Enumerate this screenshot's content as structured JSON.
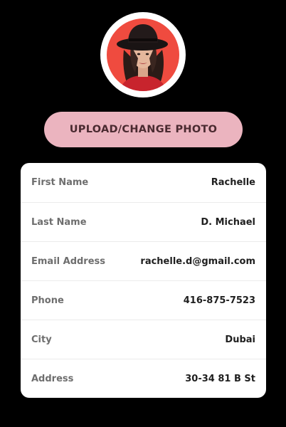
{
  "profile": {
    "avatar_icon": "profile-photo",
    "upload_button_label": "UPLOAD/CHANGE PHOTO"
  },
  "details": [
    {
      "label": "First Name",
      "value": "Rachelle"
    },
    {
      "label": "Last Name",
      "value": "D. Michael"
    },
    {
      "label": "Email Address",
      "value": "rachelle.d@gmail.com"
    },
    {
      "label": "Phone",
      "value": "416-875-7523"
    },
    {
      "label": "City",
      "value": "Dubai"
    },
    {
      "label": "Address",
      "value": "30-34 81 B St"
    }
  ],
  "colors": {
    "background": "#000000",
    "avatar_bg": "#ef4b3f",
    "button_bg": "#ebb4bf",
    "button_text": "#4a2a30",
    "card_bg": "#ffffff",
    "label_text": "#6e6e6e",
    "value_text": "#1f1f1f"
  }
}
